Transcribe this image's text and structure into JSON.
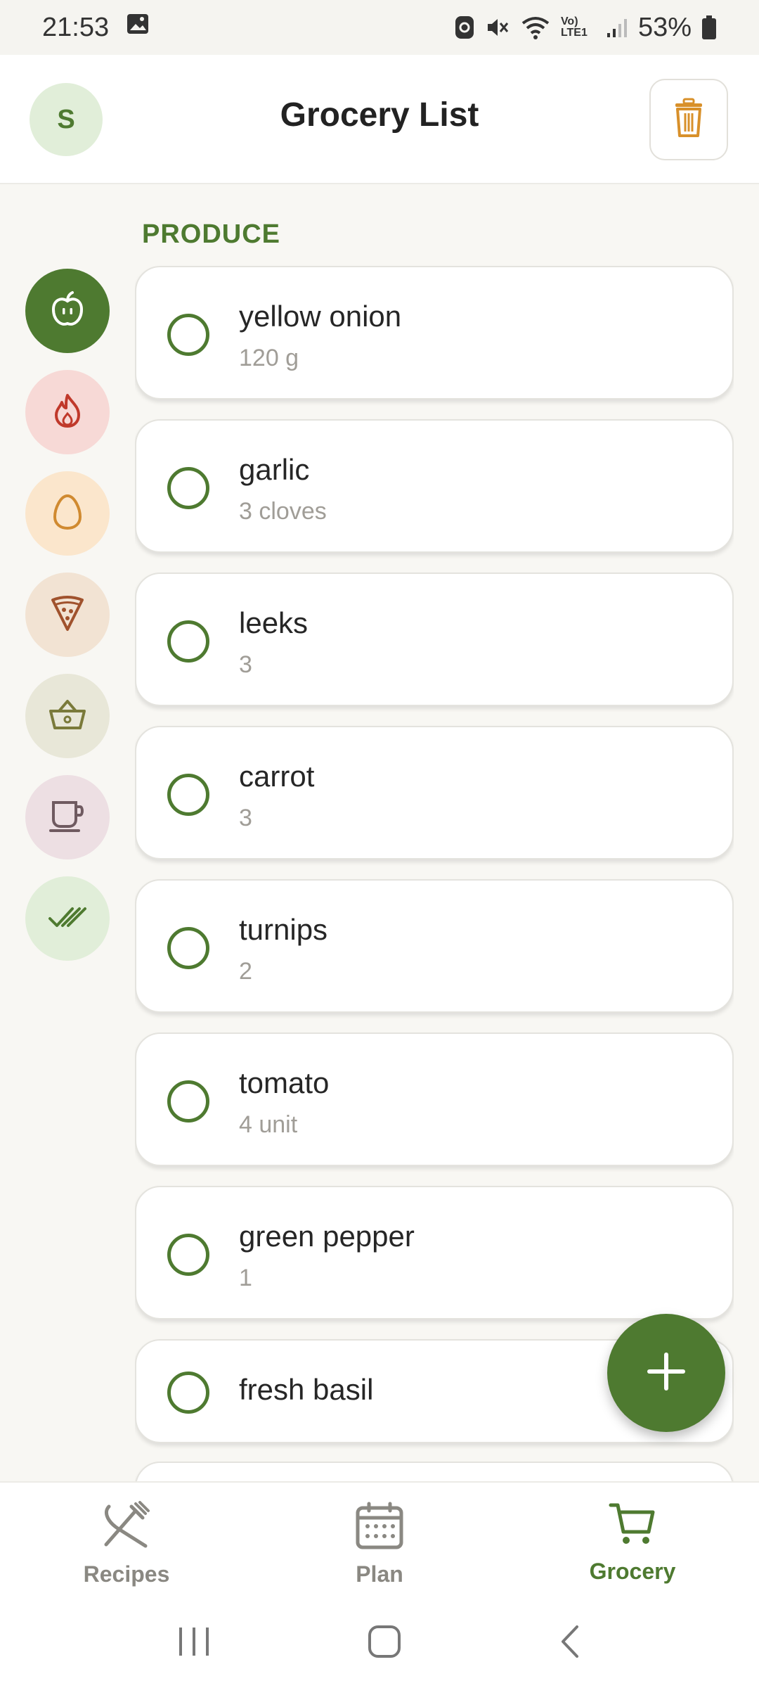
{
  "status_bar": {
    "time": "21:53",
    "battery": "53%",
    "network_label": "Vo) LTE1",
    "icons": [
      "gallery-icon",
      "location-sync-icon",
      "mute-icon",
      "wifi-icon",
      "signal-icon",
      "battery-icon"
    ]
  },
  "header": {
    "avatar_initial": "S",
    "title": "Grocery List",
    "trash_icon": "trash-icon"
  },
  "categories": [
    {
      "name": "produce",
      "icon": "apple-icon",
      "active": true,
      "color": "#4e7a30"
    },
    {
      "name": "meat",
      "icon": "flame-icon",
      "active": false,
      "color": "#f7d9d6"
    },
    {
      "name": "dairy",
      "icon": "egg-icon",
      "active": false,
      "color": "#fbe6cc"
    },
    {
      "name": "bakery",
      "icon": "pizza-icon",
      "active": false,
      "color": "#f2e3d3"
    },
    {
      "name": "pantry",
      "icon": "basket-icon",
      "active": false,
      "color": "#e8e7d8"
    },
    {
      "name": "beverages",
      "icon": "cup-icon",
      "active": false,
      "color": "#eddfe3"
    },
    {
      "name": "checked",
      "icon": "double-check-icon",
      "active": false,
      "color": "#e1eed9"
    }
  ],
  "section": {
    "title": "PRODUCE"
  },
  "items": [
    {
      "name": "yellow onion",
      "qty": "120 g"
    },
    {
      "name": "garlic",
      "qty": "3 cloves"
    },
    {
      "name": "leeks",
      "qty": "3"
    },
    {
      "name": "carrot",
      "qty": "3"
    },
    {
      "name": "turnips",
      "qty": "2"
    },
    {
      "name": "tomato",
      "qty": "4 unit"
    },
    {
      "name": "green pepper",
      "qty": "1"
    },
    {
      "name": "fresh basil",
      "qty": ""
    }
  ],
  "fab": {
    "icon": "plus-icon"
  },
  "bottom_nav": [
    {
      "label": "Recipes",
      "icon": "cutlery-icon",
      "active": false
    },
    {
      "label": "Plan",
      "icon": "calendar-icon",
      "active": false
    },
    {
      "label": "Grocery",
      "icon": "cart-icon",
      "active": true
    }
  ],
  "system_nav": [
    "recent-apps-icon",
    "home-icon",
    "back-icon"
  ],
  "colors": {
    "accent": "#4e7a30",
    "trash": "#d8902a",
    "muted_text": "#a09d97"
  }
}
